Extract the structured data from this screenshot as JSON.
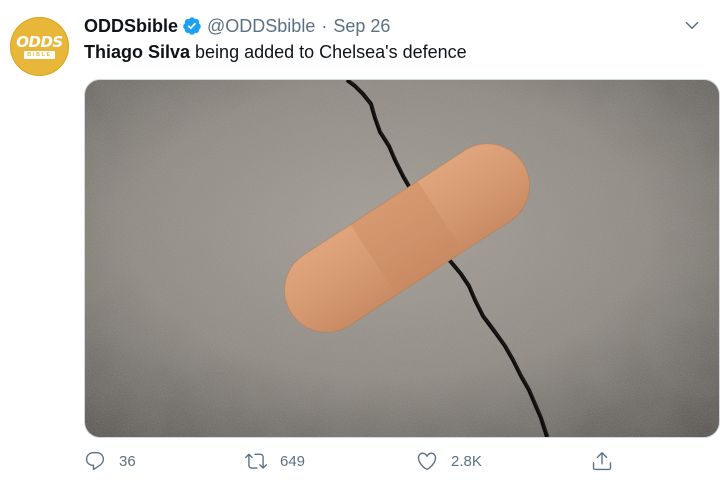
{
  "author": {
    "avatar_line1": "ODDS",
    "avatar_line2": "BIBLE",
    "name": "ODDSbible",
    "handle": "@ODDSbible",
    "separator": "·",
    "date": "Sep 26"
  },
  "tweet": {
    "text_bold": "Thiago Silva",
    "text_rest": " being added to Chelsea's defence"
  },
  "media": {
    "description_icon": "photo"
  },
  "actions": {
    "reply_count": "36",
    "retweet_count": "649",
    "like_count": "2.8K"
  },
  "colors": {
    "brand_yellow": "#e8b73a",
    "verified_blue": "#1da1f2",
    "secondary_text": "#5b7083",
    "primary_text": "#0f1419"
  }
}
